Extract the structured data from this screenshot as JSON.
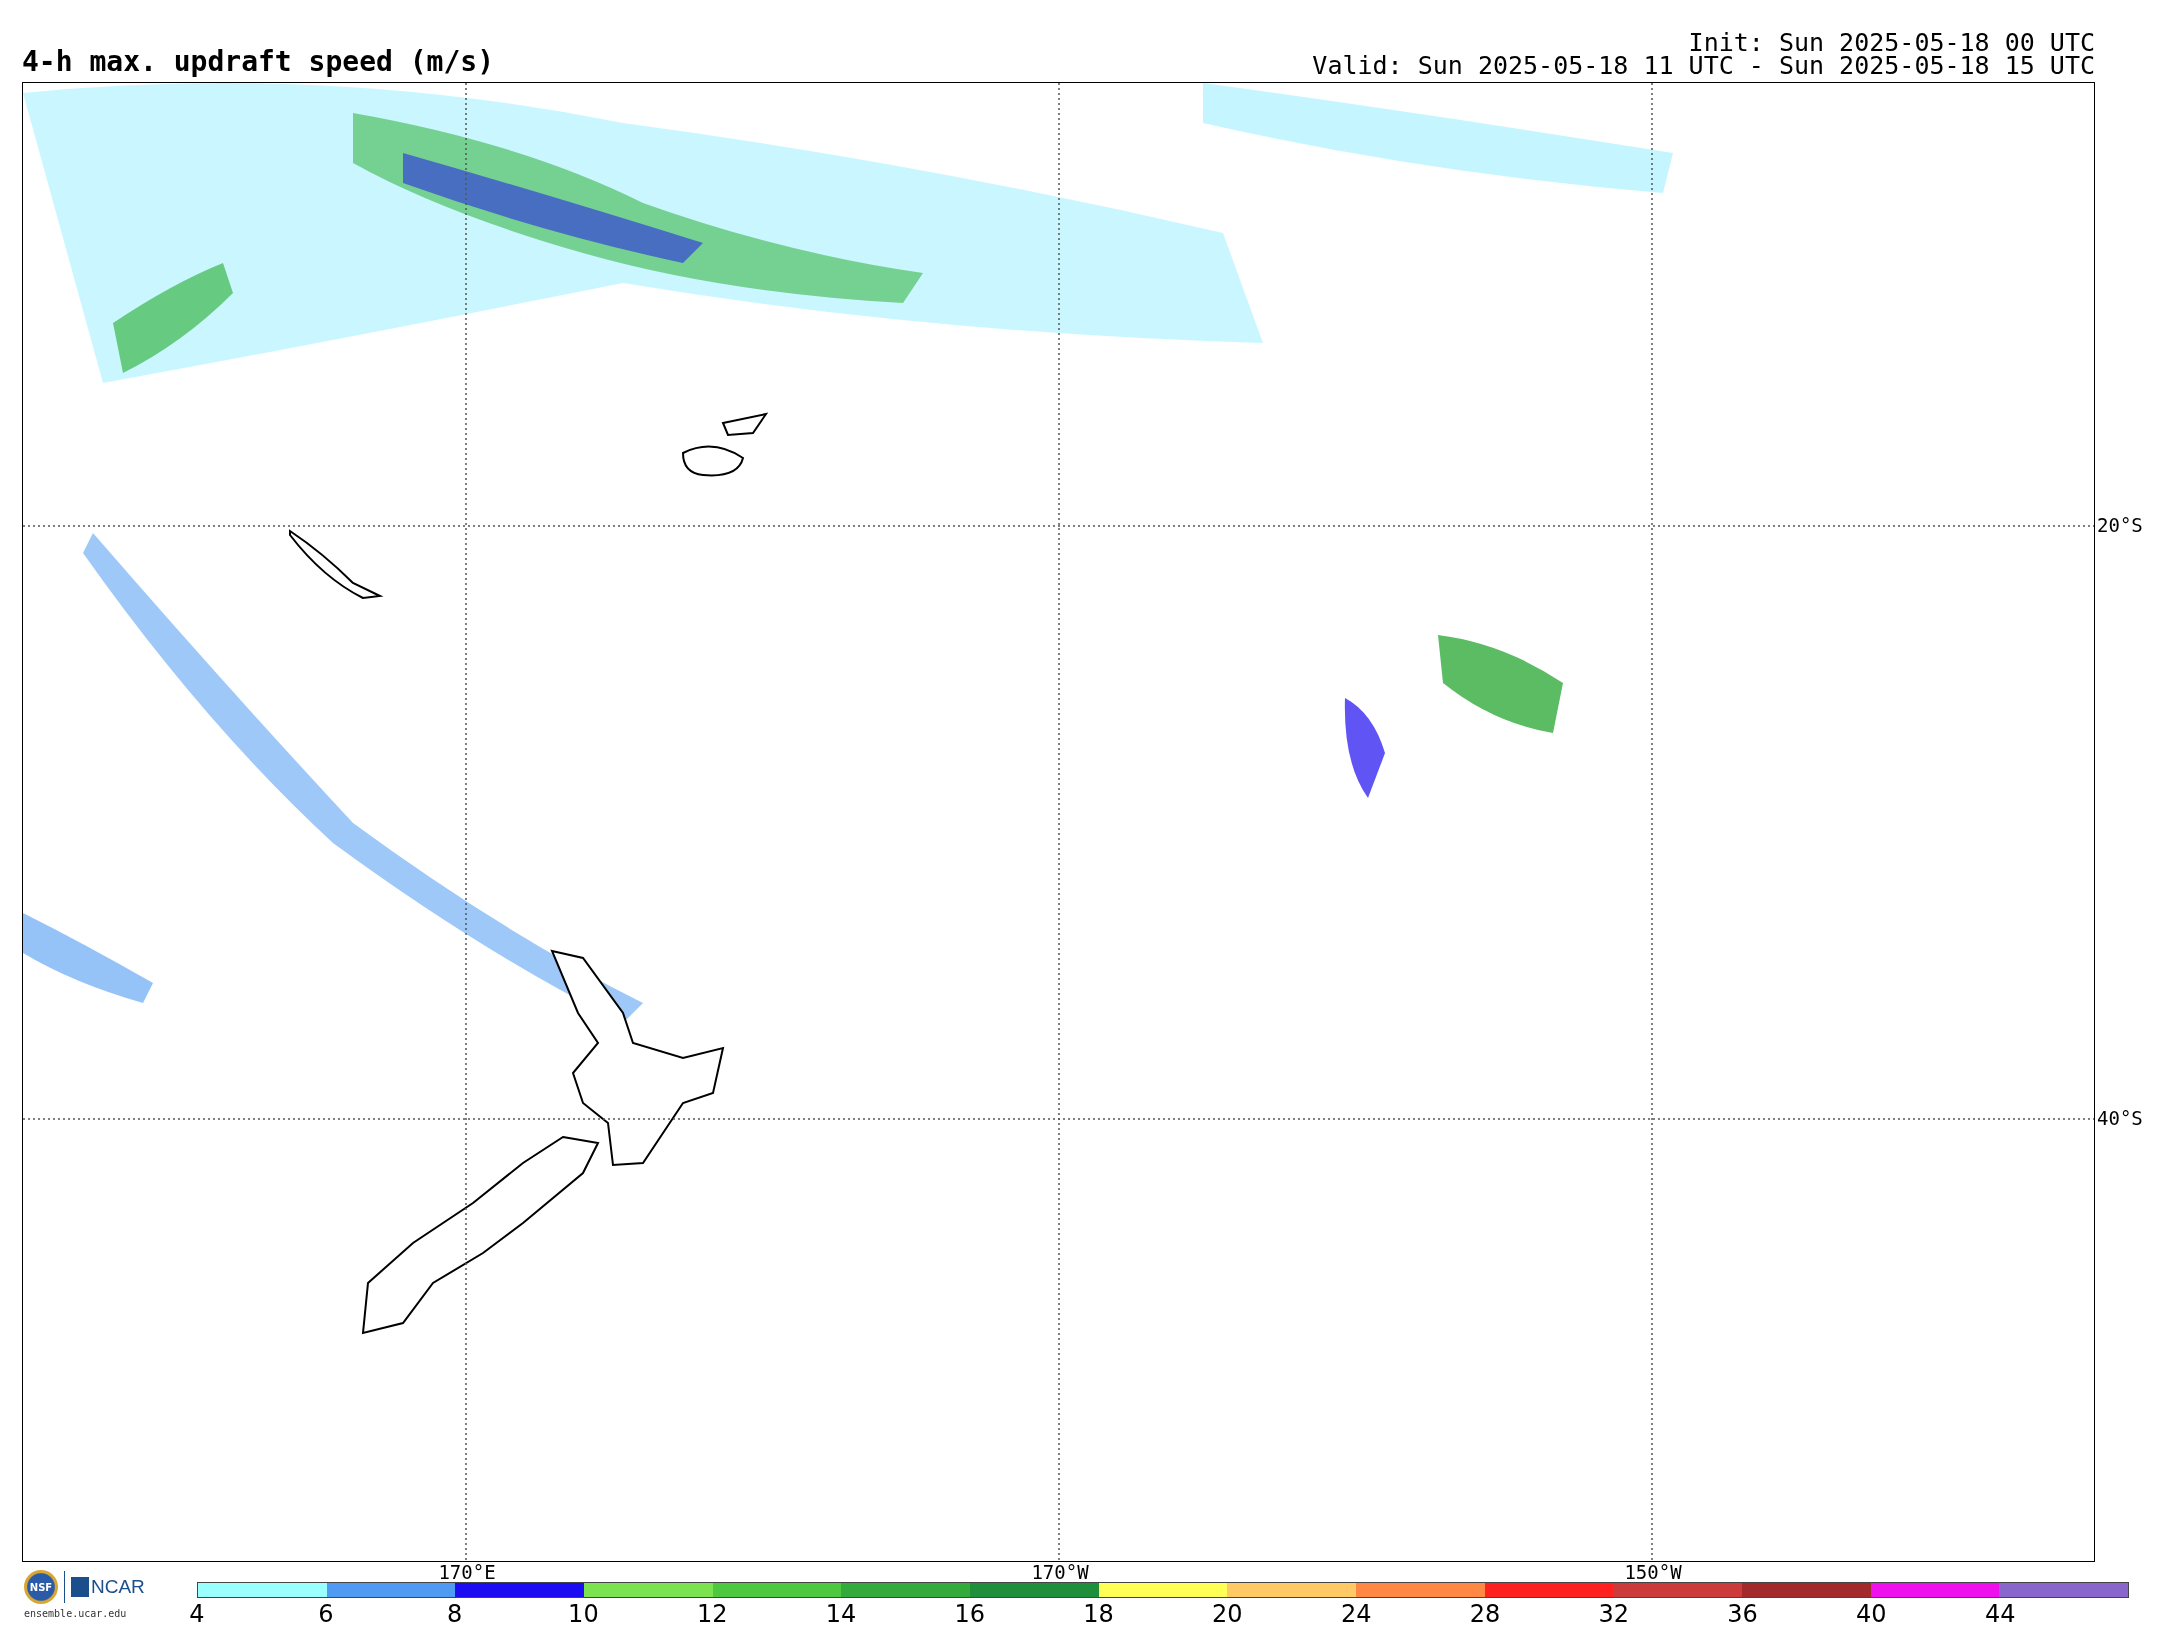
{
  "title": "4-h max. updraft speed (m/s)",
  "init": "Init: Sun 2025-05-18 00 UTC",
  "valid": "Valid: Sun 2025-05-18 11 UTC - Sun 2025-05-18 15 UTC",
  "map": {
    "longitude_labels": [
      "170°E",
      "170°W",
      "150°W"
    ],
    "latitude_labels": [
      "20°S",
      "40°S"
    ]
  },
  "logo": {
    "mark": "NSF",
    "name": "NCAR",
    "site": "ensemble.ucar.edu"
  },
  "colorbar": {
    "segments": [
      {
        "label": "4",
        "color": "#99ffff"
      },
      {
        "label": "6",
        "color": "#4f9bf3"
      },
      {
        "label": "8",
        "color": "#1c0cf1"
      },
      {
        "label": "10",
        "color": "#7be34f"
      },
      {
        "label": "12",
        "color": "#4dc840"
      },
      {
        "label": "14",
        "color": "#32ab3c"
      },
      {
        "label": "16",
        "color": "#1f8f3c"
      },
      {
        "label": "18",
        "color": "#ffff55"
      },
      {
        "label": "20",
        "color": "#ffc966"
      },
      {
        "label": "24",
        "color": "#ff8844"
      },
      {
        "label": "28",
        "color": "#ff2020"
      },
      {
        "label": "32",
        "color": "#cc3b3b"
      },
      {
        "label": "36",
        "color": "#a32a2a"
      },
      {
        "label": "40",
        "color": "#ee11ee"
      },
      {
        "label": "44",
        "color": "#8866cc"
      }
    ]
  }
}
